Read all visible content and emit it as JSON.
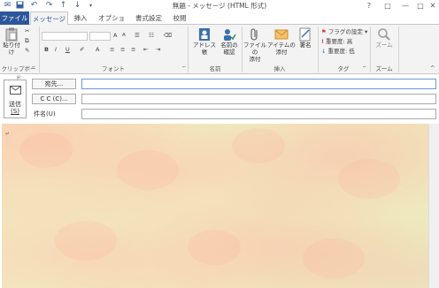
{
  "window": {
    "title": "無題 - メッセージ (HTML 形式)",
    "controls": {
      "help": "?",
      "restore": "□",
      "minimize": "—",
      "maximize": "□",
      "close": "✕"
    }
  },
  "quick_access": [
    "envelope-icon",
    "save-icon",
    "undo-icon",
    "redo-icon",
    "up-arrow-icon",
    "down-arrow-icon",
    "customize-icon"
  ],
  "tabs": [
    {
      "label": "ファイル",
      "active": false
    },
    {
      "label": "メッセージ",
      "active": true
    },
    {
      "label": "挿入",
      "active": false
    },
    {
      "label": "オプション",
      "active": false
    },
    {
      "label": "書式設定",
      "active": false
    },
    {
      "label": "校閲",
      "active": false
    }
  ],
  "ribbon": {
    "clipboard": {
      "paste": "貼り付け",
      "group": "クリップボード"
    },
    "font": {
      "group": "フォント",
      "bold": "B",
      "italic": "I",
      "underline": "U",
      "grow": "A",
      "shrink": "A"
    },
    "names": {
      "address_book": "アドレス帳",
      "check_names_1": "名前の",
      "check_names_2": "確認",
      "group": "名前"
    },
    "insert": {
      "attach_file_1": "ファイルの",
      "attach_file_2": "添付",
      "attach_item_1": "アイテムの",
      "attach_item_2": "添付",
      "signature": "署名",
      "group": "挿入"
    },
    "tags": {
      "flag": "フラグの設定",
      "high": "重要度: 高",
      "low": "重要度: 低",
      "group": "タグ"
    },
    "zoom": {
      "zoom": "ズーム",
      "group": "ズーム"
    }
  },
  "compose": {
    "send_1": "送信",
    "send_2": "(S)",
    "to": "宛先...",
    "cc": "C C (C)...",
    "subject": "件名(U)",
    "to_value": "",
    "cc_value": "",
    "subject_value": ""
  },
  "body": {
    "cursor_mark": "↵"
  },
  "colors": {
    "file_tab": "#2b579a",
    "ribbon_bg": "#f3f3f3",
    "accent": "#2b579a"
  }
}
